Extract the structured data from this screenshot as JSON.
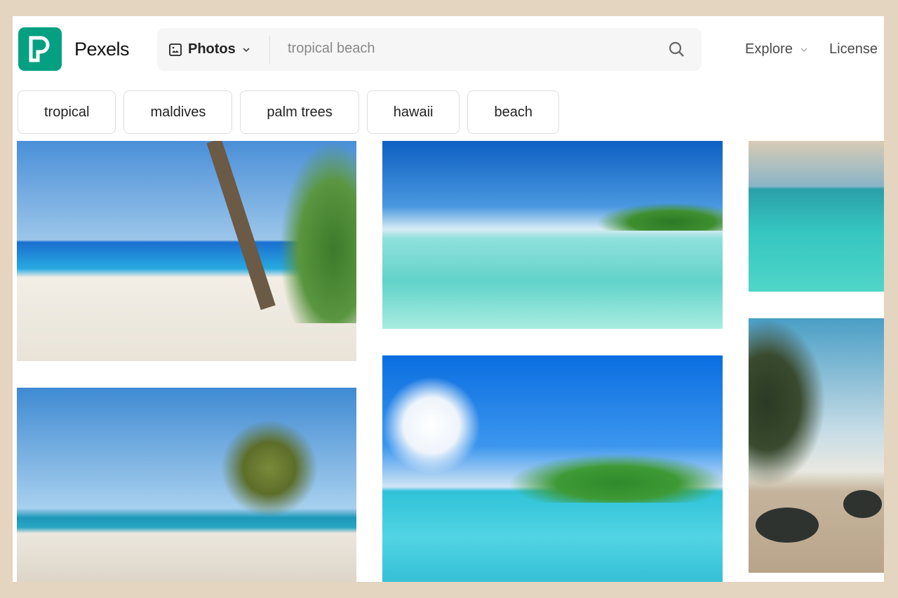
{
  "header": {
    "brand": "Pexels",
    "search_type": "Photos",
    "search_query": "tropical beach",
    "nav": [
      {
        "label": "Explore"
      },
      {
        "label": "License"
      }
    ]
  },
  "chips": [
    {
      "label": "tropical"
    },
    {
      "label": "maldives"
    },
    {
      "label": "palm trees"
    },
    {
      "label": "hawaii"
    },
    {
      "label": "beach"
    }
  ],
  "colors": {
    "brand": "#05a081",
    "frame": "#e4d5c0"
  },
  "photos": [
    {
      "column": 1,
      "subject": "beach-palm-leaning"
    },
    {
      "column": 1,
      "subject": "beach-windswept-palms"
    },
    {
      "column": 2,
      "subject": "clear-lagoon-water"
    },
    {
      "column": 2,
      "subject": "island-resort-turquoise"
    },
    {
      "column": 3,
      "subject": "turquoise-sandbar"
    },
    {
      "column": 3,
      "subject": "sunset-palms-rocks"
    }
  ]
}
